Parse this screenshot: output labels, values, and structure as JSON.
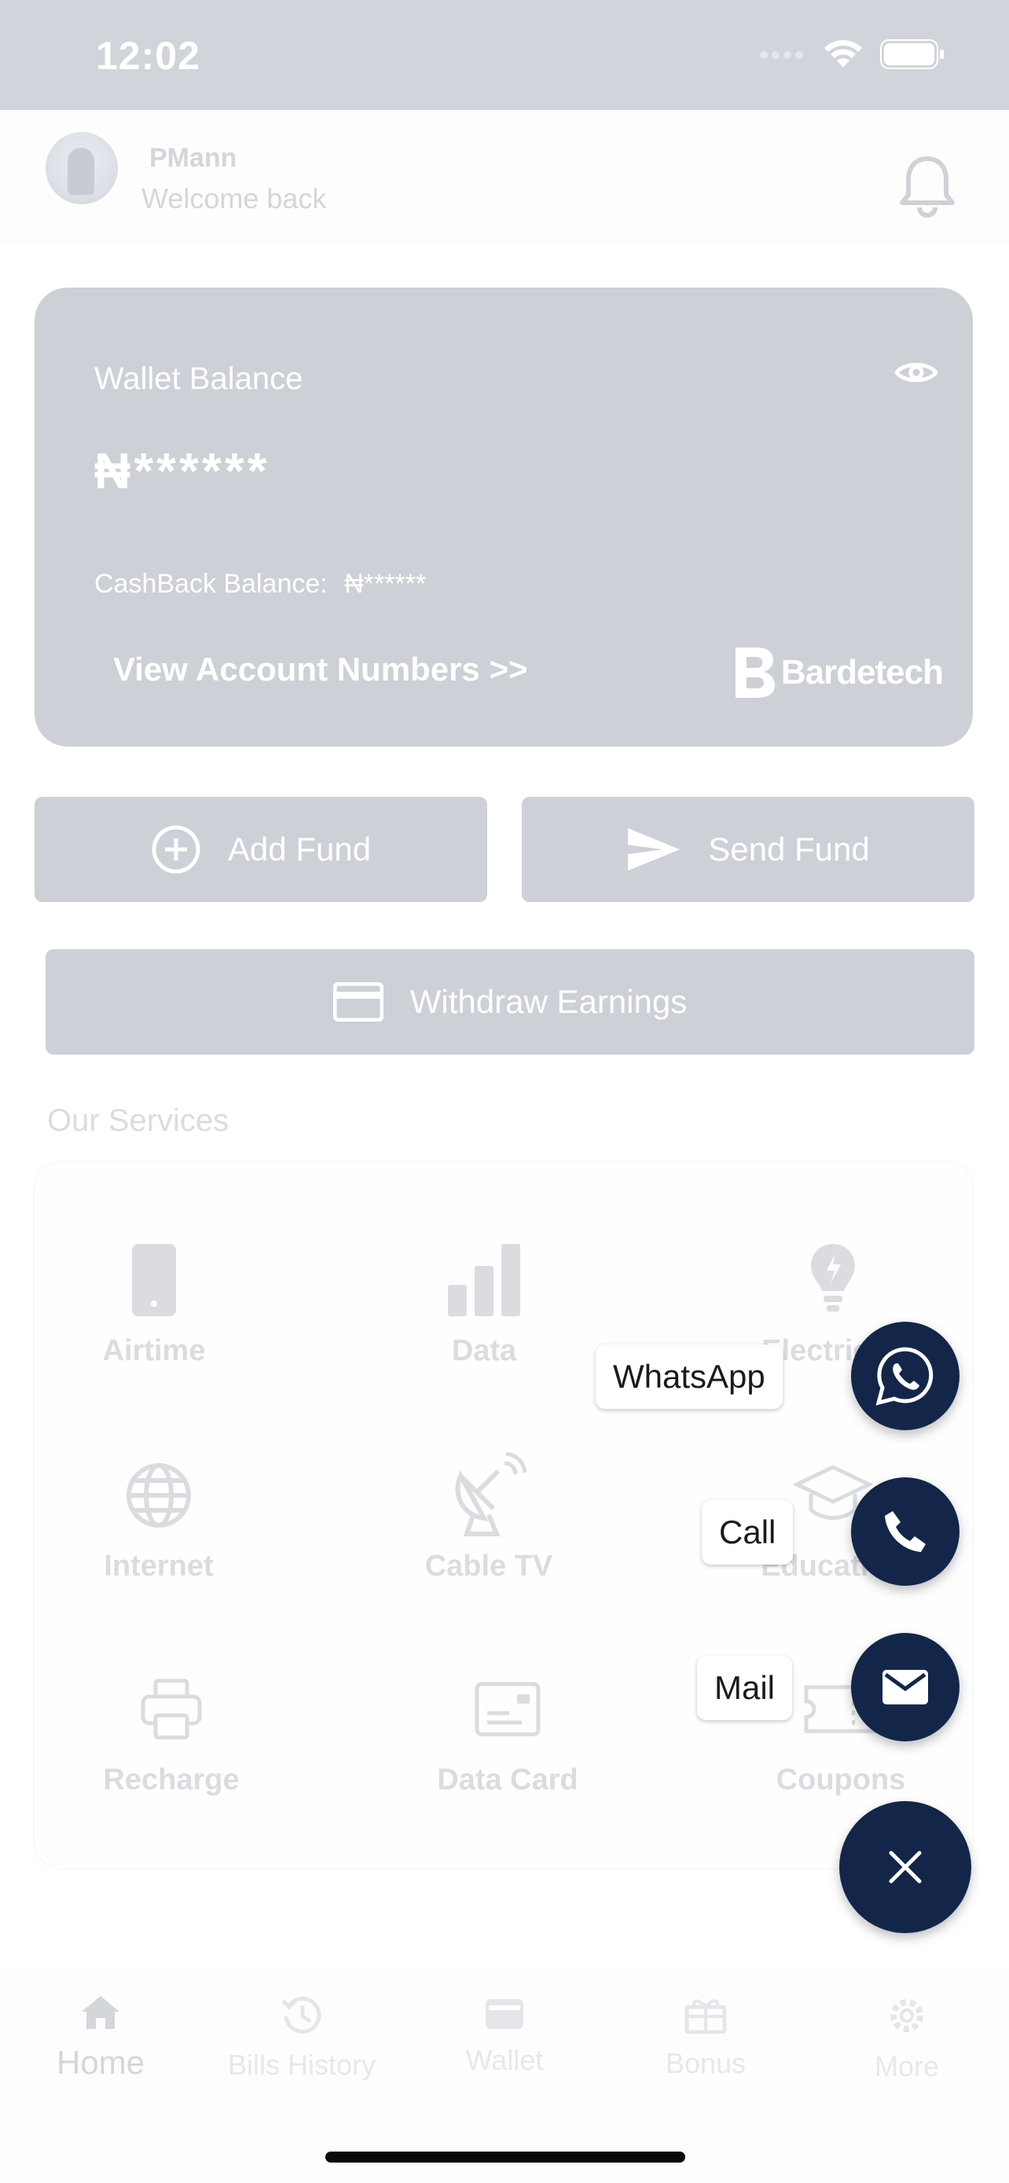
{
  "status_bar": {
    "time": "12:02"
  },
  "header": {
    "user_name": "PMann",
    "greeting": "Welcome back"
  },
  "wallet": {
    "label": "Wallet Balance",
    "balance": "₦******",
    "cashback_label": "CashBack Balance:",
    "cashback_value": "₦******",
    "view_accounts": "View Account Numbers >>",
    "brand": "Bardetech"
  },
  "actions": {
    "add_fund": "Add Fund",
    "send_fund": "Send Fund",
    "withdraw": "Withdraw Earnings"
  },
  "services": {
    "title": "Our Services",
    "items": [
      {
        "label": "Airtime",
        "icon": "phone-icon"
      },
      {
        "label": "Data",
        "icon": "signal-bars-icon"
      },
      {
        "label": "Electricity",
        "icon": "bulb-icon"
      },
      {
        "label": "Internet",
        "icon": "globe-icon"
      },
      {
        "label": "Cable TV",
        "icon": "satellite-dish-icon"
      },
      {
        "label": "Education",
        "icon": "graduation-cap-icon"
      },
      {
        "label": "Recharge",
        "icon": "printer-icon"
      },
      {
        "label": "Data Card",
        "icon": "card-icon"
      },
      {
        "label": "Coupons",
        "icon": "ticket-icon"
      }
    ]
  },
  "contact_menu": {
    "whatsapp": "WhatsApp",
    "call": "Call",
    "mail": "Mail"
  },
  "bottom_nav": {
    "items": [
      {
        "label": "Home",
        "icon": "home-icon",
        "active": true
      },
      {
        "label": "Bills History",
        "icon": "history-icon",
        "active": false
      },
      {
        "label": "Wallet",
        "icon": "wallet-icon",
        "active": false
      },
      {
        "label": "Bonus",
        "icon": "gift-icon",
        "active": false
      },
      {
        "label": "More",
        "icon": "gear-icon",
        "active": false
      }
    ]
  },
  "colors": {
    "fab": "#13264a",
    "card": "#cdd0d6",
    "status_bar": "#d1d4da"
  }
}
